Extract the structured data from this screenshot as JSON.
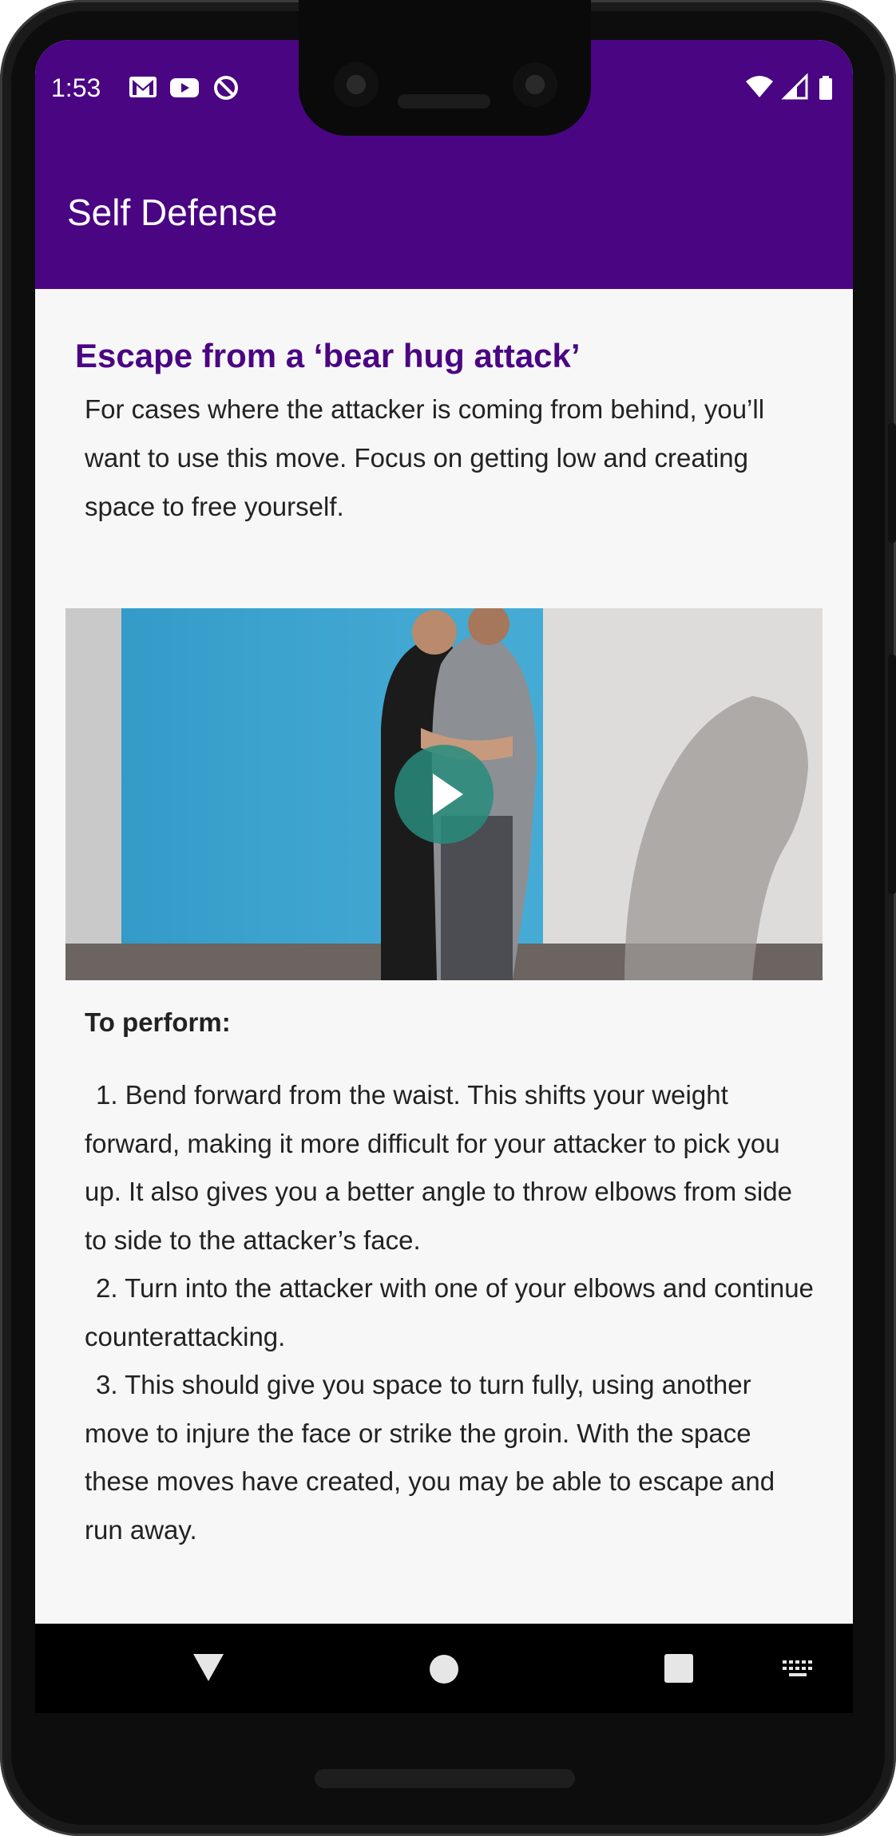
{
  "status_bar": {
    "time": "1:53",
    "left_icons": [
      "gmail-icon",
      "youtube-icon",
      "data-saver-icon"
    ],
    "right_icons": [
      "wifi-icon",
      "cellular-signal-icon",
      "battery-icon"
    ]
  },
  "app_bar": {
    "title": "Self Defense"
  },
  "article": {
    "heading": "Escape from a ‘bear hug attack’",
    "intro": "For cases where the attacker is coming from behind, you’ll want to use this move. Focus on getting low and creating space to free yourself.",
    "video": {
      "play_icon": "play-icon"
    },
    "perform_label": "To perform:",
    "steps": [
      {
        "num": "1.",
        "text": "Bend forward from the waist. This shifts your weight forward, making it more difficult for your attacker to pick you up. It also gives you a better angle to throw elbows from side to side to the attacker’s face."
      },
      {
        "num": "2.",
        "text": "Turn into the attacker with one of your elbows and continue counterattacking."
      },
      {
        "num": "3.",
        "text": "This should give you space to turn fully, using another move to injure the face or strike the groin. With the space these moves have created, you may be able to escape and run away."
      }
    ]
  },
  "nav_bar": {
    "buttons": [
      "back-icon",
      "home-icon",
      "recents-icon",
      "keyboard-icon"
    ]
  },
  "colors": {
    "primary": "#4a0583",
    "background": "#f7f7f7",
    "text": "#222222"
  }
}
